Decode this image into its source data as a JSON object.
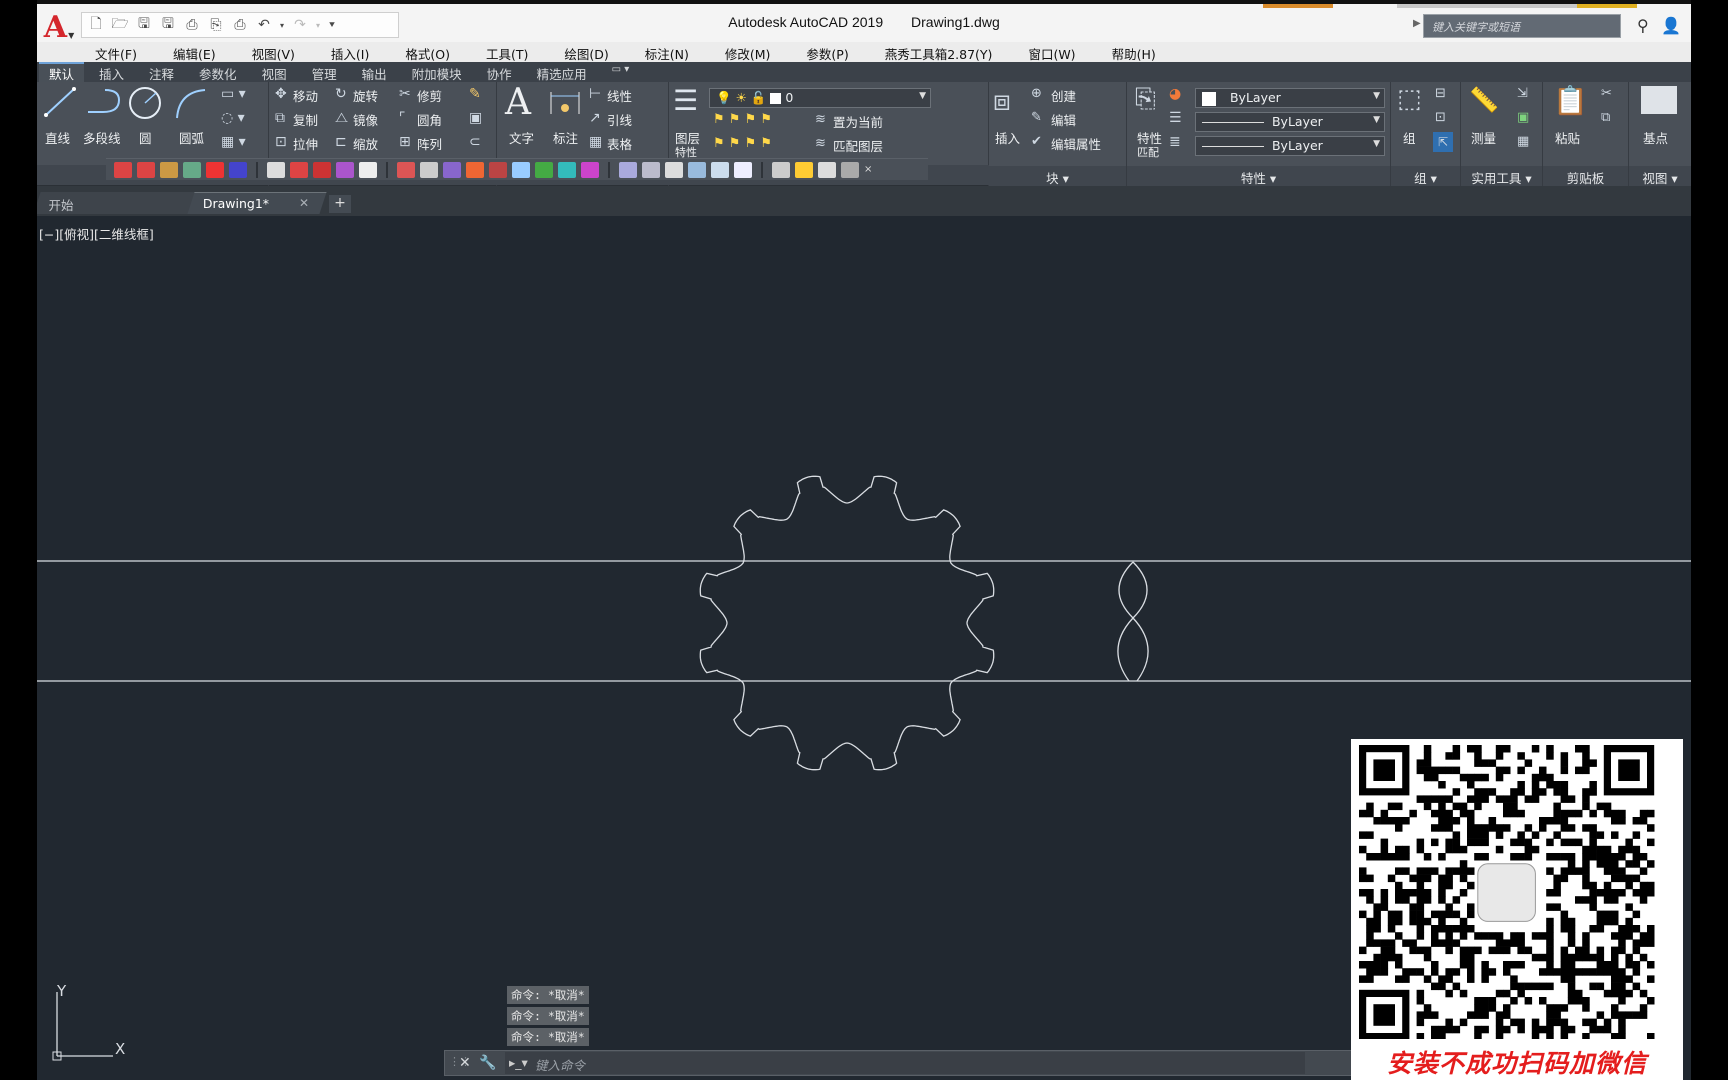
{
  "window": {
    "app_title": "Autodesk AutoCAD 2019",
    "file_name": "Drawing1.dwg",
    "search_placeholder": "键入关键字或短语"
  },
  "menu": [
    "文件(F)",
    "编辑(E)",
    "视图(V)",
    "插入(I)",
    "格式(O)",
    "工具(T)",
    "绘图(D)",
    "标注(N)",
    "修改(M)",
    "参数(P)",
    "燕秀工具箱2.87(Y)",
    "窗口(W)",
    "帮助(H)"
  ],
  "ribbon_tabs": [
    "默认",
    "插入",
    "注释",
    "参数化",
    "视图",
    "管理",
    "输出",
    "附加模块",
    "协作",
    "精选应用"
  ],
  "ribbon": {
    "draw": {
      "line": "直线",
      "polyline": "多段线",
      "circle": "圆",
      "arc": "圆弧"
    },
    "modify": {
      "move": "移动",
      "rotate": "旋转",
      "trim": "修剪",
      "copy": "复制",
      "mirror": "镜像",
      "fillet": "圆角",
      "stretch": "拉伸",
      "scale": "缩放",
      "array": "阵列"
    },
    "annotation": {
      "text": "文字",
      "dimension": "标注",
      "linear": "线性",
      "leader": "引线",
      "table": "表格"
    },
    "layers": {
      "layer_props": "图层",
      "layer_props2": "特性",
      "current_layer": "0",
      "set_current": "置为当前",
      "match_layer": "匹配图层"
    },
    "block": {
      "insert": "插入",
      "create": "创建",
      "edit": "编辑",
      "edit_attr": "编辑属性",
      "title": "块"
    },
    "properties": {
      "match": "特性",
      "match2": "匹配",
      "color": "ByLayer",
      "linetype": "ByLayer",
      "lineweight": "ByLayer",
      "title": "特性"
    },
    "groups": {
      "group": "组",
      "title": "组"
    },
    "utilities": {
      "measure": "测量",
      "title": "实用工具"
    },
    "clipboard": {
      "paste": "粘贴",
      "title": "剪贴板"
    },
    "view": {
      "base": "基点",
      "title": "视图"
    }
  },
  "file_tabs": {
    "start": "开始",
    "drawing": "Drawing1*"
  },
  "canvas": {
    "view_control": "[−][俯视][二维线框]",
    "ucs_x": "X",
    "ucs_y": "Y"
  },
  "command": {
    "history": [
      "命令: *取消*",
      "命令: *取消*",
      "命令: *取消*"
    ],
    "placeholder": "键入命令"
  },
  "overlay": {
    "caption": "安装不成功扫码加微信"
  },
  "colors": {
    "canvas_bg": "#212830",
    "ribbon_bg": "#4a5058",
    "drawing_line": "#d9dde2",
    "brand_red": "#d4262c"
  }
}
